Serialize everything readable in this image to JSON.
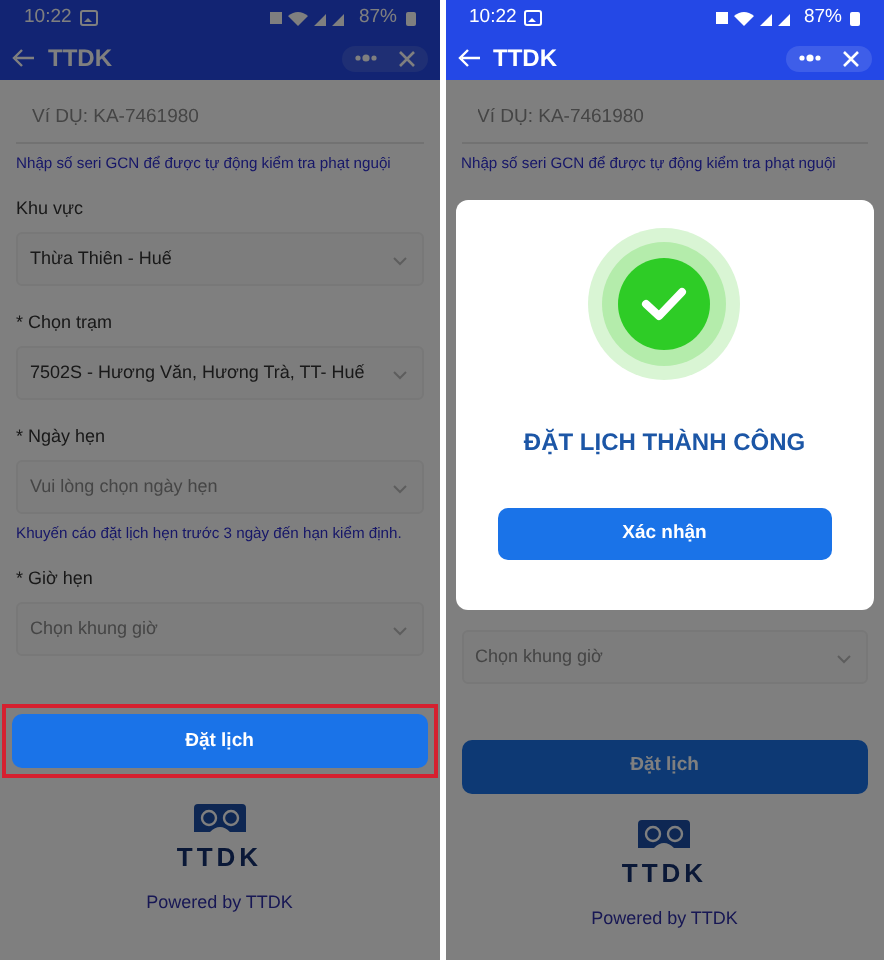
{
  "screens": [
    {
      "status_bar": {
        "time": "10:22",
        "battery": "87%"
      },
      "header": {
        "title": "TTDK"
      },
      "overlay_covers_header": true,
      "items": [
        {
          "kind": "input",
          "placeholder": "Ví DỤ: KA-7461980"
        },
        {
          "kind": "hint",
          "text": "Nhập số seri GCN để được tự động kiểm tra phạt nguội"
        },
        {
          "kind": "label",
          "text": "Khu vực"
        },
        {
          "kind": "select",
          "value": "Thừa Thiên - Huế"
        },
        {
          "kind": "label",
          "text": "* Chọn trạm"
        },
        {
          "kind": "select",
          "value": "7502S - Hương Văn, Hương Trà, TT- Huế"
        },
        {
          "kind": "label",
          "text": "* Ngày hẹn"
        },
        {
          "kind": "select",
          "placeholder": "Vui lòng chọn ngày hẹn"
        },
        {
          "kind": "hint",
          "text": "Khuyến cáo đặt lịch hẹn trước 3 ngày đến hạn kiểm định."
        },
        {
          "kind": "label",
          "text": "* Giờ hẹn"
        },
        {
          "kind": "select",
          "placeholder": "Chọn khung giờ"
        }
      ],
      "submit": {
        "label": "Đặt lịch",
        "highlighted": true
      },
      "footer": {
        "logo_text": "TTDK",
        "powered_by": "Powered by TTDK"
      }
    },
    {
      "status_bar": {
        "time": "10:22",
        "battery": "87%"
      },
      "header": {
        "title": "TTDK"
      },
      "overlay_covers_header": false,
      "items": [
        {
          "kind": "input",
          "placeholder": "Ví DỤ: KA-7461980"
        },
        {
          "kind": "hint",
          "text": "Nhập số seri GCN để được tự động kiểm tra phạt nguội"
        },
        {
          "kind": "dialog",
          "title": "ĐẶT LỊCH THÀNH CÔNG",
          "button": "Xác nhận"
        },
        {
          "kind": "select",
          "placeholder": "Chọn khung giờ"
        }
      ],
      "submit": {
        "label": "Đặt lịch",
        "highlighted": false
      },
      "footer": {
        "logo_text": "TTDK",
        "powered_by": "Powered by TTDK"
      }
    }
  ]
}
